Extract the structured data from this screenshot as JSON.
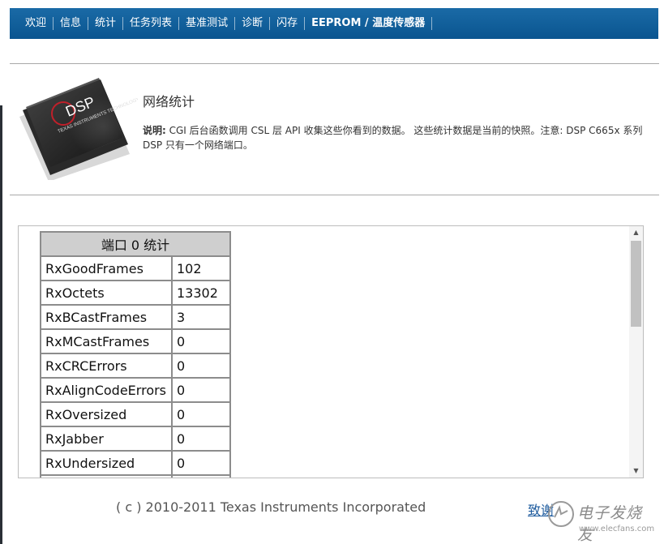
{
  "nav": {
    "items": [
      "欢迎",
      "信息",
      "统计",
      "任务列表",
      "基准测试",
      "诊断",
      "闪存",
      "EEPROM / 温度传感器"
    ]
  },
  "logo": {
    "chip_text": "DSP",
    "chip_subtext": "TEXAS INSTRUMENTS TECHNOLOGY"
  },
  "header": {
    "title": "网络统计",
    "desc_label": "说明:",
    "desc_text": " CGI 后台函数调用 CSL 层 API 收集这些你看到的数据。 这些统计数据是当前的快照。注意: DSP C665x 系列 DSP 只有一个网络端口。"
  },
  "stats": {
    "heading": "端口 0 统计",
    "rows": [
      {
        "label": "RxGoodFrames",
        "value": "102"
      },
      {
        "label": "RxOctets",
        "value": "13302"
      },
      {
        "label": "RxBCastFrames",
        "value": "3"
      },
      {
        "label": "RxMCastFrames",
        "value": "0"
      },
      {
        "label": "RxCRCErrors",
        "value": "0"
      },
      {
        "label": "RxAlignCodeErrors",
        "value": "0"
      },
      {
        "label": "RxOversized",
        "value": "0"
      },
      {
        "label": "RxJabber",
        "value": "0"
      },
      {
        "label": "RxUndersized",
        "value": "0"
      }
    ]
  },
  "footer": {
    "copyright": "( c ) 2010-2011 Texas Instruments Incorporated",
    "thanks": "致谢"
  },
  "watermark": {
    "text": "电子发烧友",
    "url": "www.elecfans.com"
  },
  "colors": {
    "nav_bg": "#0a5590",
    "link": "#1e5b9e",
    "table_header_bg": "#cfcfcf"
  }
}
